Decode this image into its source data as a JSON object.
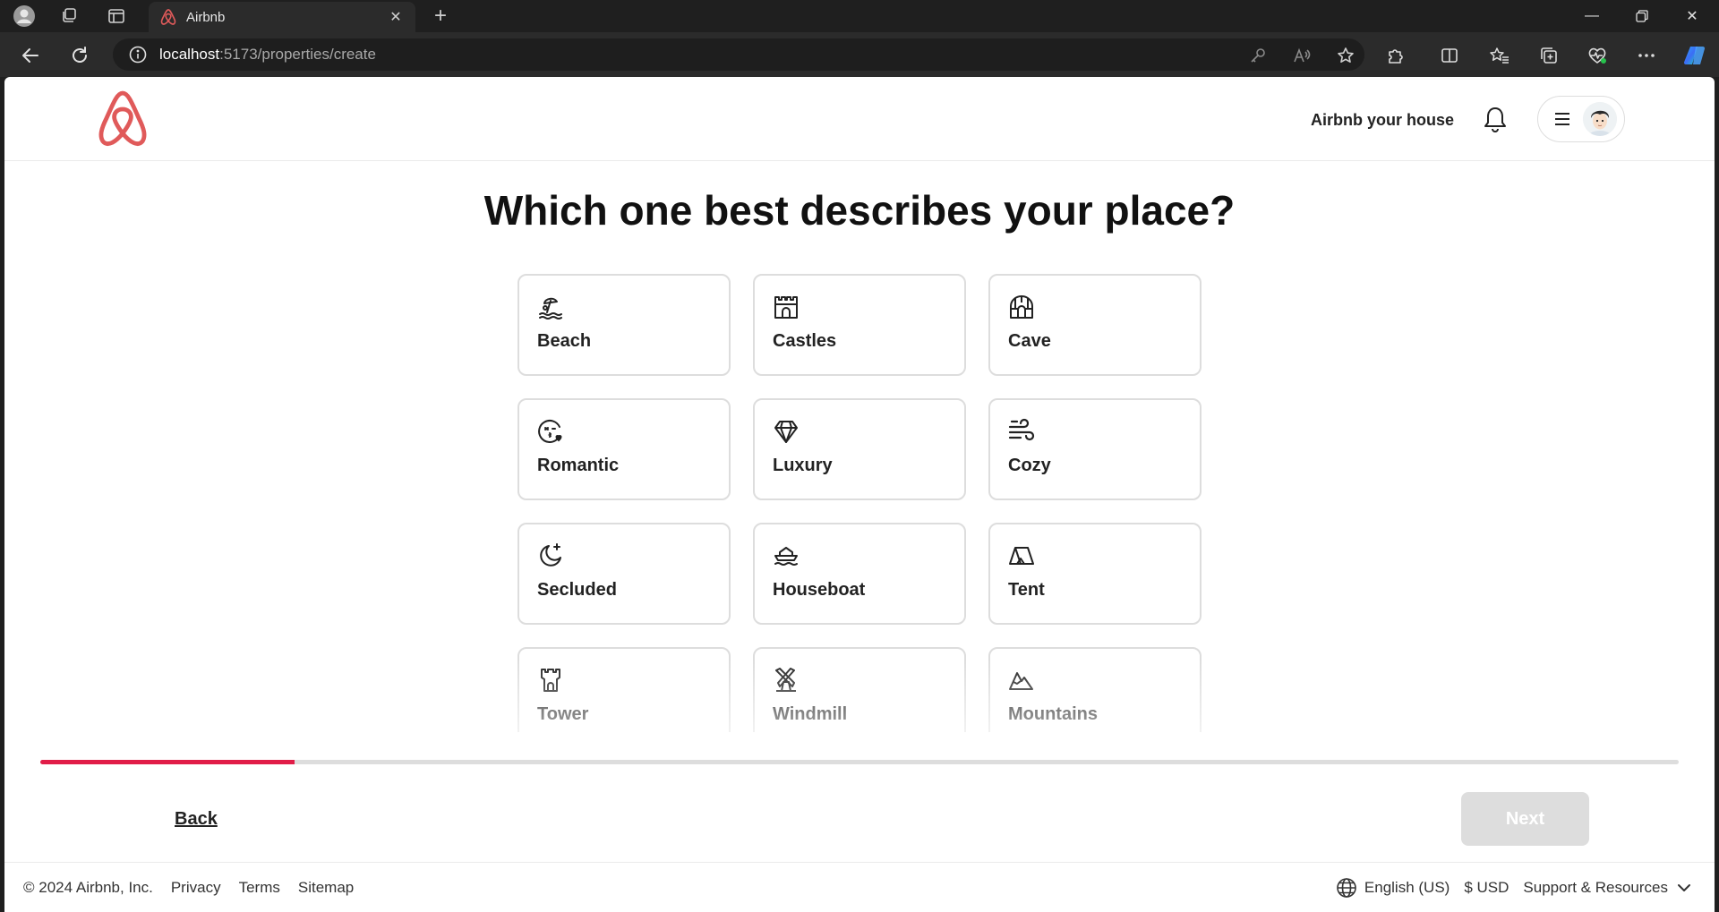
{
  "browser": {
    "tab_title": "Airbnb",
    "url_host": "localhost",
    "url_path": ":5173/properties/create"
  },
  "header": {
    "host_link": "Airbnb your house"
  },
  "page": {
    "title": "Which one best describes your place?"
  },
  "categories": [
    {
      "label": "Beach",
      "icon": "beach-icon"
    },
    {
      "label": "Castles",
      "icon": "castle-icon"
    },
    {
      "label": "Cave",
      "icon": "cave-icon"
    },
    {
      "label": "Romantic",
      "icon": "kiss-face-icon"
    },
    {
      "label": "Luxury",
      "icon": "diamond-icon"
    },
    {
      "label": "Cozy",
      "icon": "wind-icon"
    },
    {
      "label": "Secluded",
      "icon": "moon-icon"
    },
    {
      "label": "Houseboat",
      "icon": "houseboat-icon"
    },
    {
      "label": "Tent",
      "icon": "tent-icon"
    },
    {
      "label": "Tower",
      "icon": "tower-icon"
    },
    {
      "label": "Windmill",
      "icon": "windmill-icon"
    },
    {
      "label": "Mountains",
      "icon": "mountains-icon"
    }
  ],
  "progress": {
    "value": 0.155,
    "color": "#e11d48"
  },
  "actions": {
    "back_label": "Back",
    "next_label": "Next"
  },
  "footer": {
    "copyright": "© 2024 Airbnb, Inc.",
    "links": [
      "Privacy",
      "Terms",
      "Sitemap"
    ],
    "language": "English (US)",
    "currency": "$ USD",
    "support": "Support & Resources"
  },
  "colors": {
    "brand": "#e05a5a",
    "card_border": "#dddddd"
  }
}
